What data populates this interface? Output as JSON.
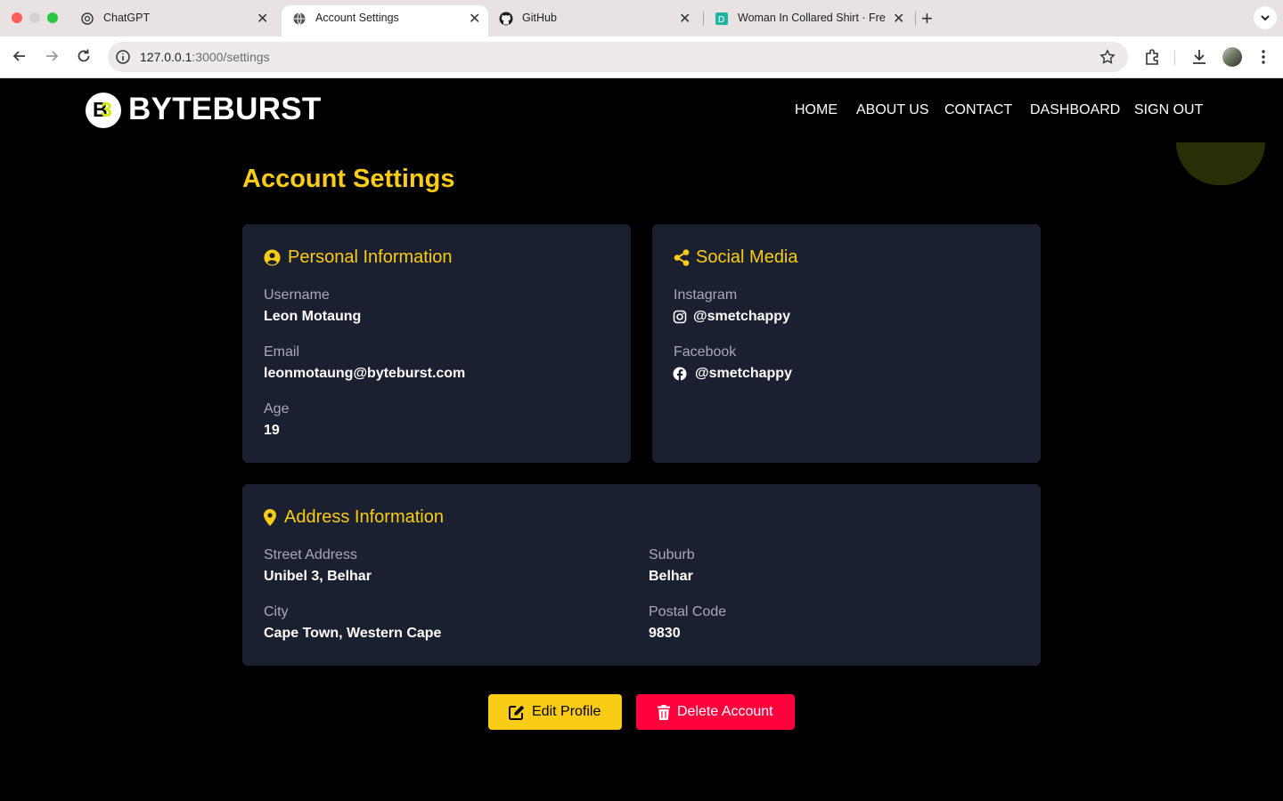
{
  "browser": {
    "tabs": [
      {
        "title": "ChatGPT",
        "icon": "chatgpt-icon"
      },
      {
        "title": "Account Settings",
        "icon": "globe-icon"
      },
      {
        "title": "GitHub",
        "icon": "github-icon"
      },
      {
        "title": "Woman In Collared Shirt · Free",
        "icon": "d-favicon-icon"
      }
    ],
    "url_host": "127.0.0.1",
    "url_path": ":3000/settings"
  },
  "header": {
    "logo_text": "BYTEBURST",
    "nav": [
      "HOME",
      "ABOUT US",
      "CONTACT",
      "DASHBOARD",
      "SIGN OUT"
    ]
  },
  "page_title": "Account Settings",
  "personal": {
    "title": "Personal Information",
    "username_label": "Username",
    "username": "Leon Motaung",
    "email_label": "Email",
    "email": "leonmotaung@byteburst.com",
    "age_label": "Age",
    "age": "19"
  },
  "social": {
    "title": "Social Media",
    "instagram_label": "Instagram",
    "instagram": "@smetchappy",
    "facebook_label": "Facebook",
    "facebook": "@smetchappy"
  },
  "address": {
    "title": "Address Information",
    "street_label": "Street Address",
    "street": "Unibel 3, Belhar",
    "suburb_label": "Suburb",
    "suburb": "Belhar",
    "city_label": "City",
    "city": "Cape Town, Western Cape",
    "postal_label": "Postal Code",
    "postal": "9830"
  },
  "actions": {
    "edit_label": "Edit Profile",
    "delete_label": "Delete Account"
  },
  "colors": {
    "accent": "#facc15",
    "danger": "#ff003d",
    "card": "#1b2030",
    "background": "#000000"
  }
}
